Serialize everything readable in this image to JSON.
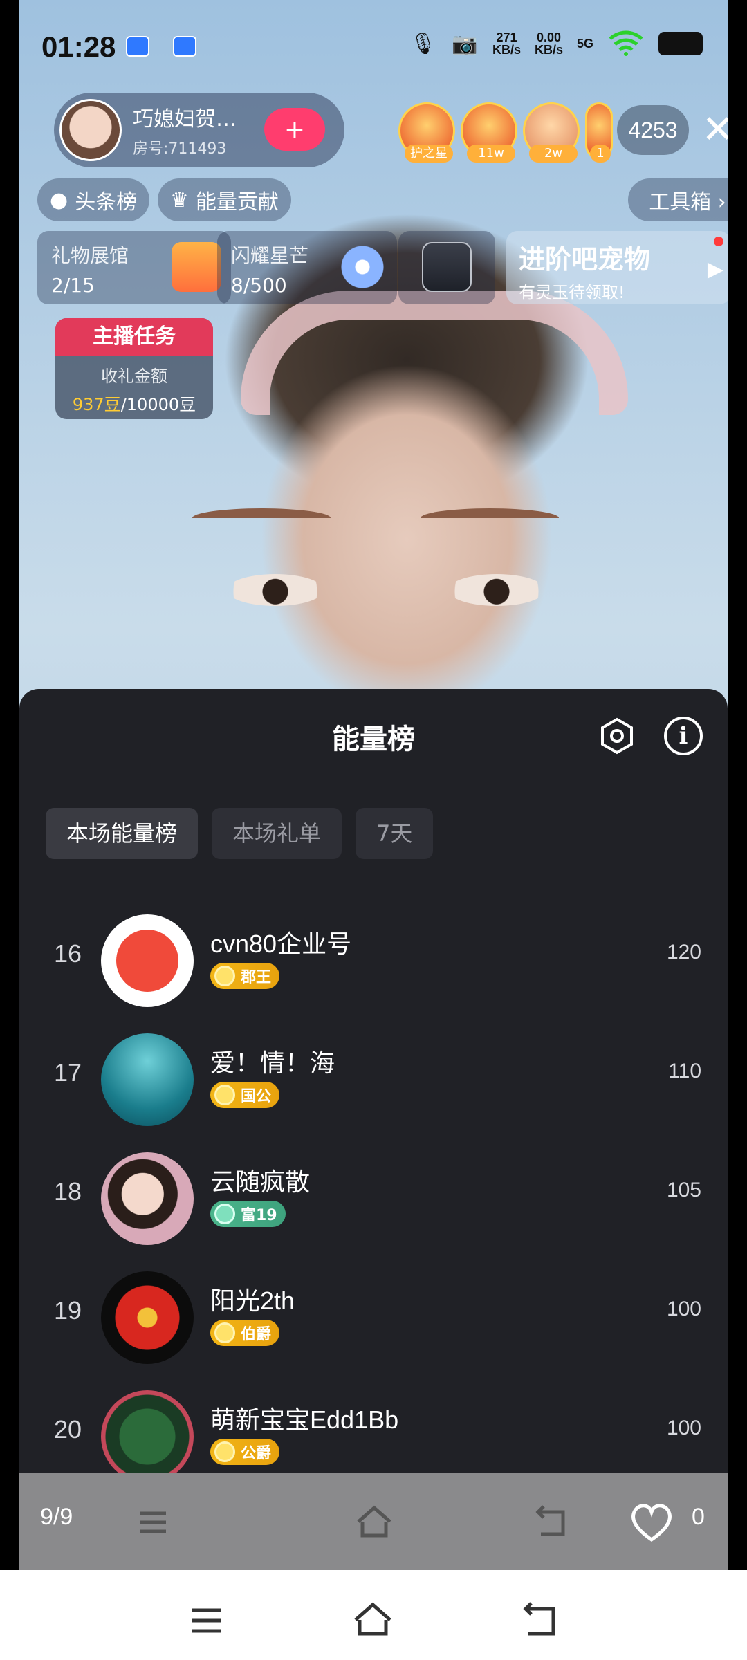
{
  "status_bar": {
    "time": "01:28",
    "net_speed_up": "271\nKB/s",
    "net_speed_down": "0.00\nKB/s",
    "signal": "5G"
  },
  "host": {
    "name": "巧媳妇贺…",
    "room_id": "房号:711493",
    "follow_label": "+"
  },
  "top_fans": [
    {
      "badge": "护之星"
    },
    {
      "badge": "11w"
    },
    {
      "badge": "2w"
    },
    {
      "badge": "1"
    }
  ],
  "viewer_count": "4253",
  "pills": {
    "headline_rank": "头条榜",
    "energy_contribution": "能量贡献",
    "toolbox": "工具箱 ›"
  },
  "cards": {
    "gift_gallery_title": "礼物展馆",
    "gift_gallery_value": "2/15",
    "shine_star_title": "闪耀星芒",
    "shine_star_value": "8/500",
    "promo_title": "进阶吧宠物",
    "promo_subtitle": "有灵玉待领取!"
  },
  "task": {
    "header": "主播任务",
    "label": "收礼金额",
    "current": "937豆",
    "target": "/10000豆"
  },
  "sheet": {
    "title": "能量榜",
    "tabs": [
      {
        "label": "本场能量榜",
        "active": true
      },
      {
        "label": "本场礼单",
        "active": false
      },
      {
        "label": "7天",
        "active": false
      }
    ],
    "rows": [
      {
        "rank": "16",
        "name": "cvn80企业号",
        "level": "郡王",
        "level_color": "gold",
        "score": "120"
      },
      {
        "rank": "17",
        "name": "爱！情！海",
        "level": "国公",
        "level_color": "gold",
        "score": "110"
      },
      {
        "rank": "18",
        "name": "云随疯散",
        "level": "富19",
        "level_color": "green",
        "score": "105"
      },
      {
        "rank": "19",
        "name": "阳光2th",
        "level": "伯爵",
        "level_color": "gold",
        "score": "100"
      },
      {
        "rank": "20",
        "name": "萌新宝宝Edd1Bb",
        "level": "公爵",
        "level_color": "gold",
        "score": "100"
      }
    ]
  },
  "app_nav": {
    "page_indicator": "9/9",
    "likes": "0"
  },
  "icons": {
    "settings": "hexagon-gear-icon",
    "info": "info-icon",
    "close": "close-icon",
    "heart": "heart-icon",
    "menu": "menu-icon",
    "home": "home-icon",
    "back": "back-icon"
  },
  "colors": {
    "sheet_bg": "#202126",
    "accent_pink": "#ff3d6e",
    "task_red": "#e23a5a",
    "gold": "#f2b516"
  }
}
